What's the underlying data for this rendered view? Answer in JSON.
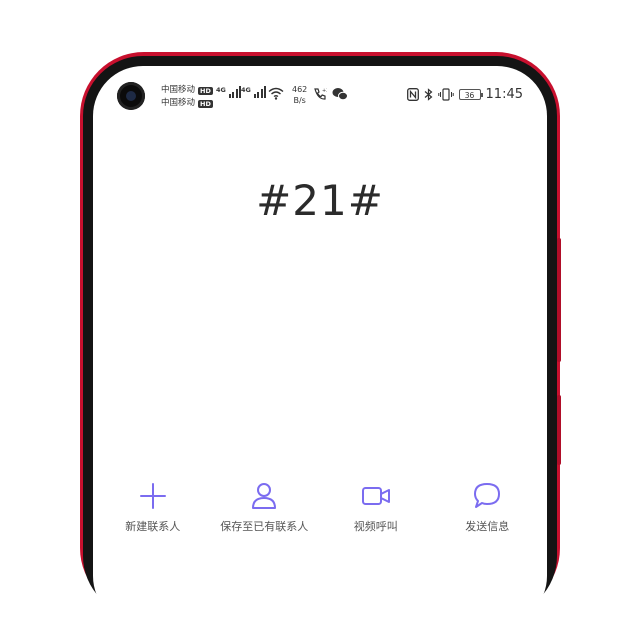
{
  "status_bar": {
    "carrier1": "中国移动",
    "carrier2": "中国移动",
    "hd": "HD",
    "net1": "4G",
    "net2": "4G",
    "speed_value": "462",
    "speed_unit": "B/s",
    "battery": "36",
    "time": "11:45"
  },
  "dialer": {
    "number": "#21#"
  },
  "actions": {
    "new_contact": "新建联系人",
    "save_existing": "保存至已有联系人",
    "video_call": "视频呼叫",
    "send_message": "发送信息"
  },
  "colors": {
    "accent": "#7b6cf0",
    "frame": "#c8102e"
  }
}
